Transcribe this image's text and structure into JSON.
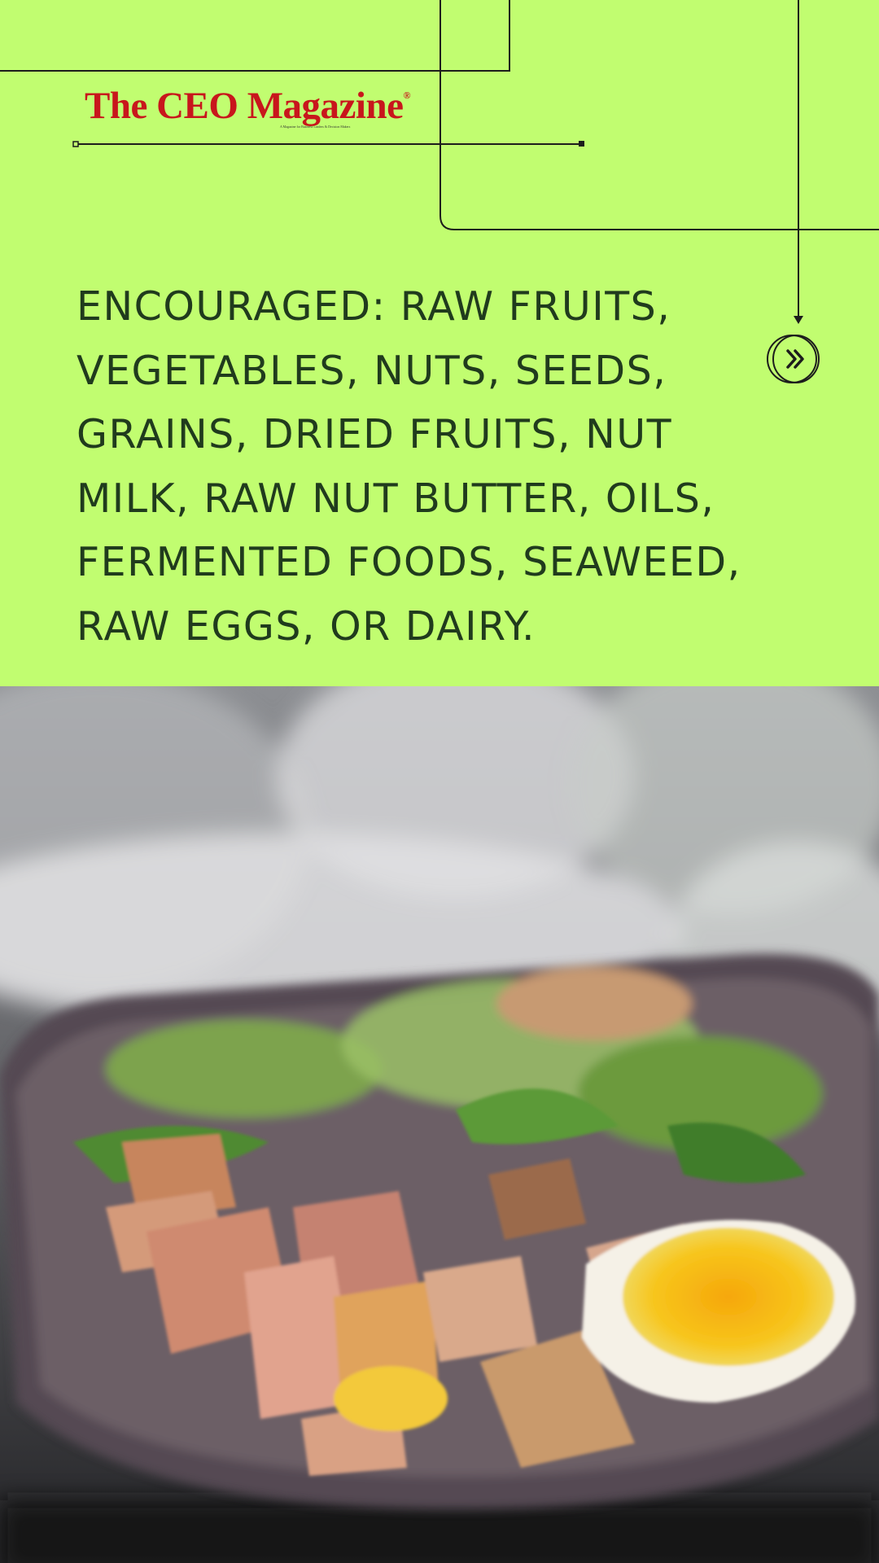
{
  "brand": {
    "name": "The CEO Magazine",
    "registered_mark": "®",
    "tagline": "A Magazine for Business Leaders & Decision Makers"
  },
  "headline": "ENCOURAGED: RAW FRUITS, VEGETABLES, NUTS, SEEDS, GRAINS, DRIED FRUITS, NUT MILK, RAW NUT BUTTER, OILS, FERMENTED FOODS, SEAWEED, RAW EGGS, OR DAIRY.",
  "navigation": {
    "next_icon": "double-chevron-right-icon"
  },
  "colors": {
    "background": "#c1fd70",
    "headline_text": "#203b1d",
    "brand_red": "#c8161c",
    "line": "#1c1c1c"
  },
  "photo": {
    "subject_icon": "salad-bowl-photo"
  }
}
